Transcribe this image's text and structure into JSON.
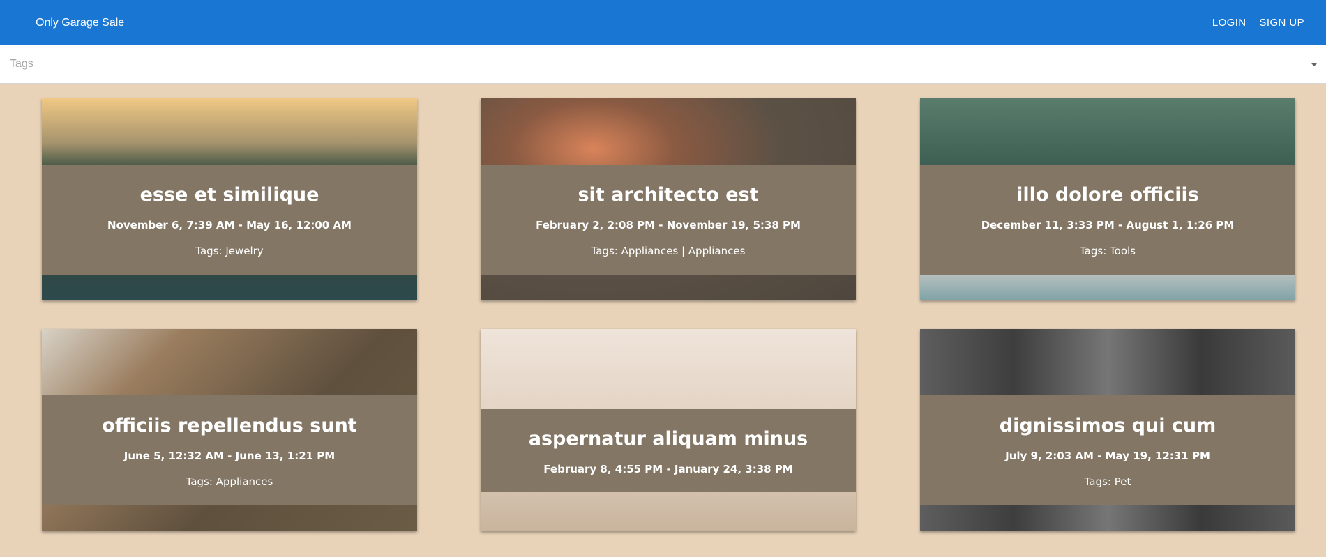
{
  "header": {
    "title": "Only Garage Sale",
    "login_label": "LOGIN",
    "signup_label": "SIGN UP"
  },
  "filter": {
    "placeholder": "Tags"
  },
  "colors": {
    "appbar": "#1976d2",
    "page_background": "#e8d3b9",
    "card_overlay": "#837665"
  },
  "cards": [
    {
      "title": "esse et similique",
      "dates": "November 6, 7:39 AM - May 16, 12:00 AM",
      "tags": "Tags: Jewelry"
    },
    {
      "title": "sit architecto est",
      "dates": "February 2, 2:08 PM - November 19, 5:38 PM",
      "tags": "Tags: Appliances | Appliances"
    },
    {
      "title": "illo dolore officiis",
      "dates": "December 11, 3:33 PM - August 1, 1:26 PM",
      "tags": "Tags: Tools"
    },
    {
      "title": "officiis repellendus sunt",
      "dates": "June 5, 12:32 AM - June 13, 1:21 PM",
      "tags": "Tags: Appliances"
    },
    {
      "title": "aspernatur aliquam minus",
      "dates": "February 8, 4:55 PM - January 24, 3:38 PM",
      "tags": ""
    },
    {
      "title": "dignissimos qui cum",
      "dates": "July 9, 2:03 AM - May 19, 12:31 PM",
      "tags": "Tags: Pet"
    }
  ]
}
